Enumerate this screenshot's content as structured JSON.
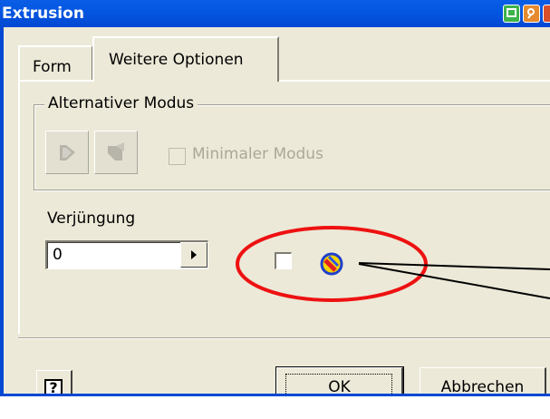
{
  "window": {
    "title": "Extrusion"
  },
  "tabs": [
    {
      "label": "Form"
    },
    {
      "label": "Weitere Optionen"
    }
  ],
  "alt_mode": {
    "group_label": "Alternativer Modus",
    "minimal_mode_label": "Minimaler Modus",
    "minimal_mode_checked": false,
    "button1_icon": "extrude-direction-icon",
    "button2_icon": "extrude-direction-alt-icon"
  },
  "taper": {
    "label": "Verjüngung",
    "value": "0",
    "checkbox_checked": false,
    "icon": "taper-sphere-icon"
  },
  "annotation": {
    "circle_color": "#ee1111"
  },
  "buttons": {
    "help": "?",
    "ok": "OK",
    "cancel": "Abbrechen"
  },
  "colors": {
    "titlebar": "#0456e0",
    "dialog_bg": "#ece9d8",
    "disabled_text": "#aca899"
  }
}
